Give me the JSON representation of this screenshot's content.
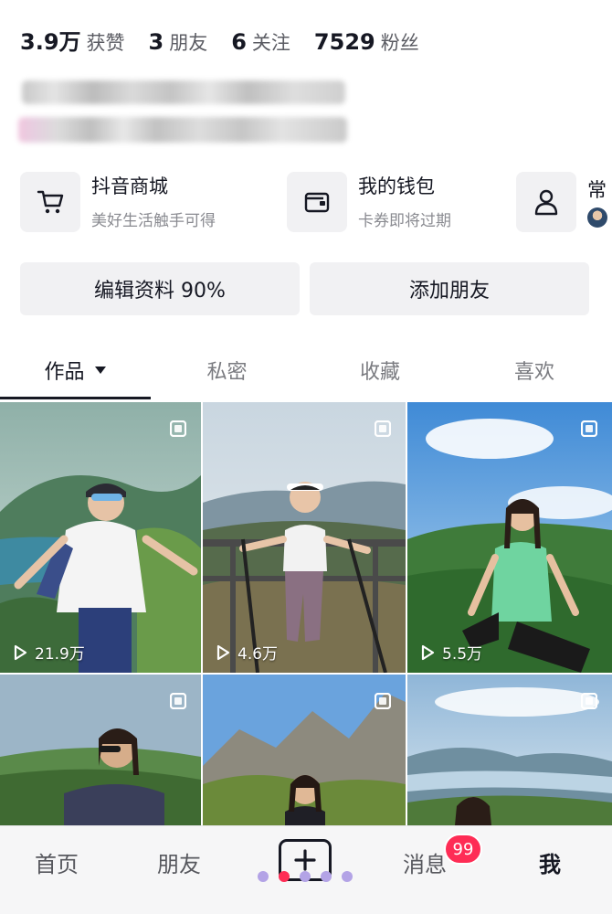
{
  "stats": [
    {
      "value": "3.9万",
      "label": "获赞"
    },
    {
      "value": "3",
      "label": "朋友"
    },
    {
      "value": "6",
      "label": "关注"
    },
    {
      "value": "7529",
      "label": "粉丝"
    }
  ],
  "services": [
    {
      "title": "抖音商城",
      "subtitle": "美好生活触手可得",
      "icon": "cart-icon"
    },
    {
      "title": "我的钱包",
      "subtitle": "卡券即将过期",
      "icon": "wallet-icon"
    },
    {
      "title": "常",
      "subtitle": "",
      "icon": "person-icon"
    }
  ],
  "actions": {
    "edit_profile": "编辑资料 90%",
    "add_friend": "添加朋友"
  },
  "tabs": [
    {
      "label": "作品",
      "active": true,
      "has_dropdown": true
    },
    {
      "label": "私密",
      "active": false
    },
    {
      "label": "收藏",
      "active": false
    },
    {
      "label": "喜欢",
      "active": false
    }
  ],
  "videos": [
    {
      "plays": "21.9万"
    },
    {
      "plays": "4.6万"
    },
    {
      "plays": "5.5万"
    },
    {
      "plays": ""
    },
    {
      "plays": ""
    },
    {
      "plays": ""
    }
  ],
  "bottom_nav": {
    "home": "首页",
    "friends": "朋友",
    "messages": "消息",
    "messages_badge": "99",
    "me": "我",
    "active": "me"
  },
  "colors": {
    "accent_red": "#fe2c55",
    "text_primary": "#161823",
    "chip_bg": "#f1f1f3",
    "dot_purple": "#b3a3e6",
    "dot_red": "#fe2c55"
  }
}
